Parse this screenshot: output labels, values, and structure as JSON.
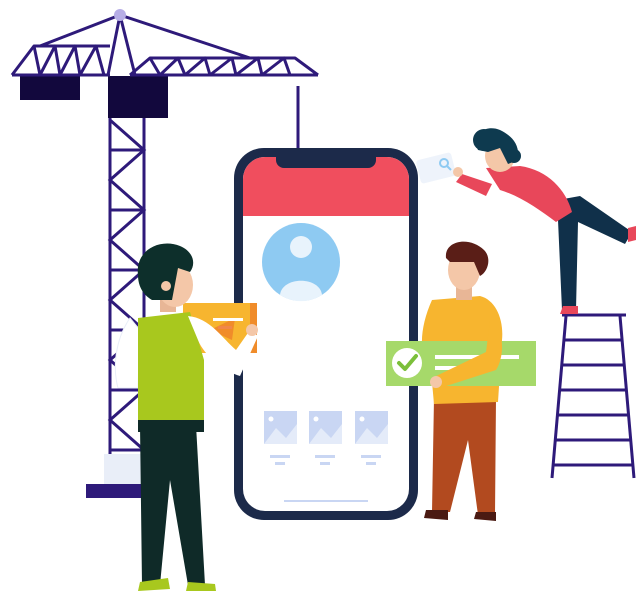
{
  "illustration": {
    "subject": "",
    "colors": {
      "crane": "#2e1a7a",
      "crane_dark": "#12083d",
      "phone_frame": "#1c2a4a",
      "phone_header": "#f04e5e",
      "avatar_bg": "#8ecaf2",
      "avatar_fg": "#e8f3fc",
      "thumbnail": "#c9d6f3",
      "yellow": "#f7b52f",
      "orange": "#f08c2a",
      "green_card": "#a6d96a",
      "green_vest": "#a8c81e",
      "pants_dark": "#0f2a28",
      "pants_brown": "#b24a1f",
      "shirt_red": "#e8475a",
      "hair_dark": "#0d2f2b",
      "hair_brown": "#5a1e17",
      "skin": "#f4c7a8",
      "skin_shadow": "#e8b696"
    }
  }
}
